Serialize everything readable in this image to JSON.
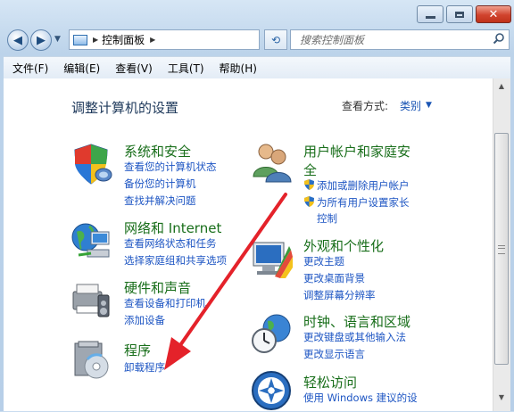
{
  "window": {
    "close_glyph": "✕"
  },
  "nav": {
    "back_glyph": "◀",
    "forward_glyph": "▶",
    "address": "控制面板",
    "address_sep": "▶",
    "refresh_glyph": "⟲",
    "search_placeholder": "搜索控制面板"
  },
  "menu": [
    "文件(F)",
    "编辑(E)",
    "查看(V)",
    "工具(T)",
    "帮助(H)"
  ],
  "main": {
    "title": "调整计算机的设置",
    "view_label": "查看方式:",
    "view_value": "类别"
  },
  "categories": {
    "system": {
      "title": "系统和安全",
      "links": [
        "查看您的计算机状态",
        "备份您的计算机",
        "查找并解决问题"
      ]
    },
    "network": {
      "title": "网络和 Internet",
      "links": [
        "查看网络状态和任务",
        "选择家庭组和共享选项"
      ]
    },
    "hardware": {
      "title": "硬件和声音",
      "links": [
        "查看设备和打印机",
        "添加设备"
      ]
    },
    "programs": {
      "title": "程序",
      "links": [
        "卸载程序"
      ]
    },
    "users": {
      "title_line1": "用户帐户和家庭安",
      "title_line2": "全",
      "links": [
        "添加或删除用户帐户",
        "为所有用户设置家长",
        "控制"
      ]
    },
    "appearance": {
      "title": "外观和个性化",
      "links": [
        "更改主题",
        "更改桌面背景",
        "调整屏幕分辨率"
      ]
    },
    "clock": {
      "title": "时钟、语言和区域",
      "links": [
        "更改键盘或其他输入法",
        "更改显示语言"
      ]
    },
    "ease": {
      "title": "轻松访问",
      "links": [
        "使用 Windows 建议的设"
      ]
    }
  },
  "colors": {
    "category_title": "#186e1a",
    "link": "#1d55c3",
    "annotation_arrow": "#e4222a"
  }
}
